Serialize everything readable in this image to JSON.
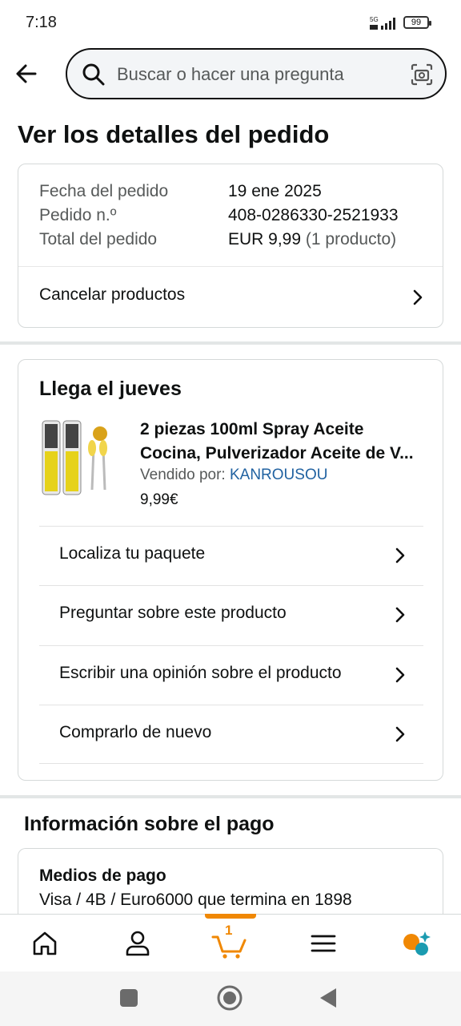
{
  "status": {
    "time": "7:18",
    "network": "5G",
    "battery": "99"
  },
  "search": {
    "placeholder": "Buscar o hacer una pregunta"
  },
  "page": {
    "title": "Ver los detalles del pedido"
  },
  "order": {
    "date_label": "Fecha del pedido",
    "date_value": "19 ene 2025",
    "number_label": "Pedido n.º",
    "number_value": "408-0286330-2521933",
    "total_label": "Total del pedido",
    "total_value": "EUR 9,99",
    "total_count": "(1 producto)",
    "cancel_label": "Cancelar productos"
  },
  "delivery": {
    "heading": "Llega el jueves",
    "product_name": "2 piezas 100ml Spray Aceite Cocina, Pulverizador Aceite de V...",
    "seller_prefix": "Vendido por:",
    "seller_name": "KANROUSOU",
    "price": "9,99€",
    "actions": [
      {
        "label": "Localiza tu paquete"
      },
      {
        "label": "Preguntar sobre este producto"
      },
      {
        "label": "Escribir una opinión sobre el producto"
      },
      {
        "label": "Comprarlo de nuevo"
      }
    ]
  },
  "payment": {
    "heading": "Información sobre el pago",
    "method_title": "Medios de pago",
    "method_value": "Visa / 4B / Euro6000 que termina en 1898"
  },
  "nav": {
    "cart_count": "1"
  },
  "colors": {
    "accent": "#f08804",
    "link": "#2162a1",
    "text": "#0f1111"
  }
}
